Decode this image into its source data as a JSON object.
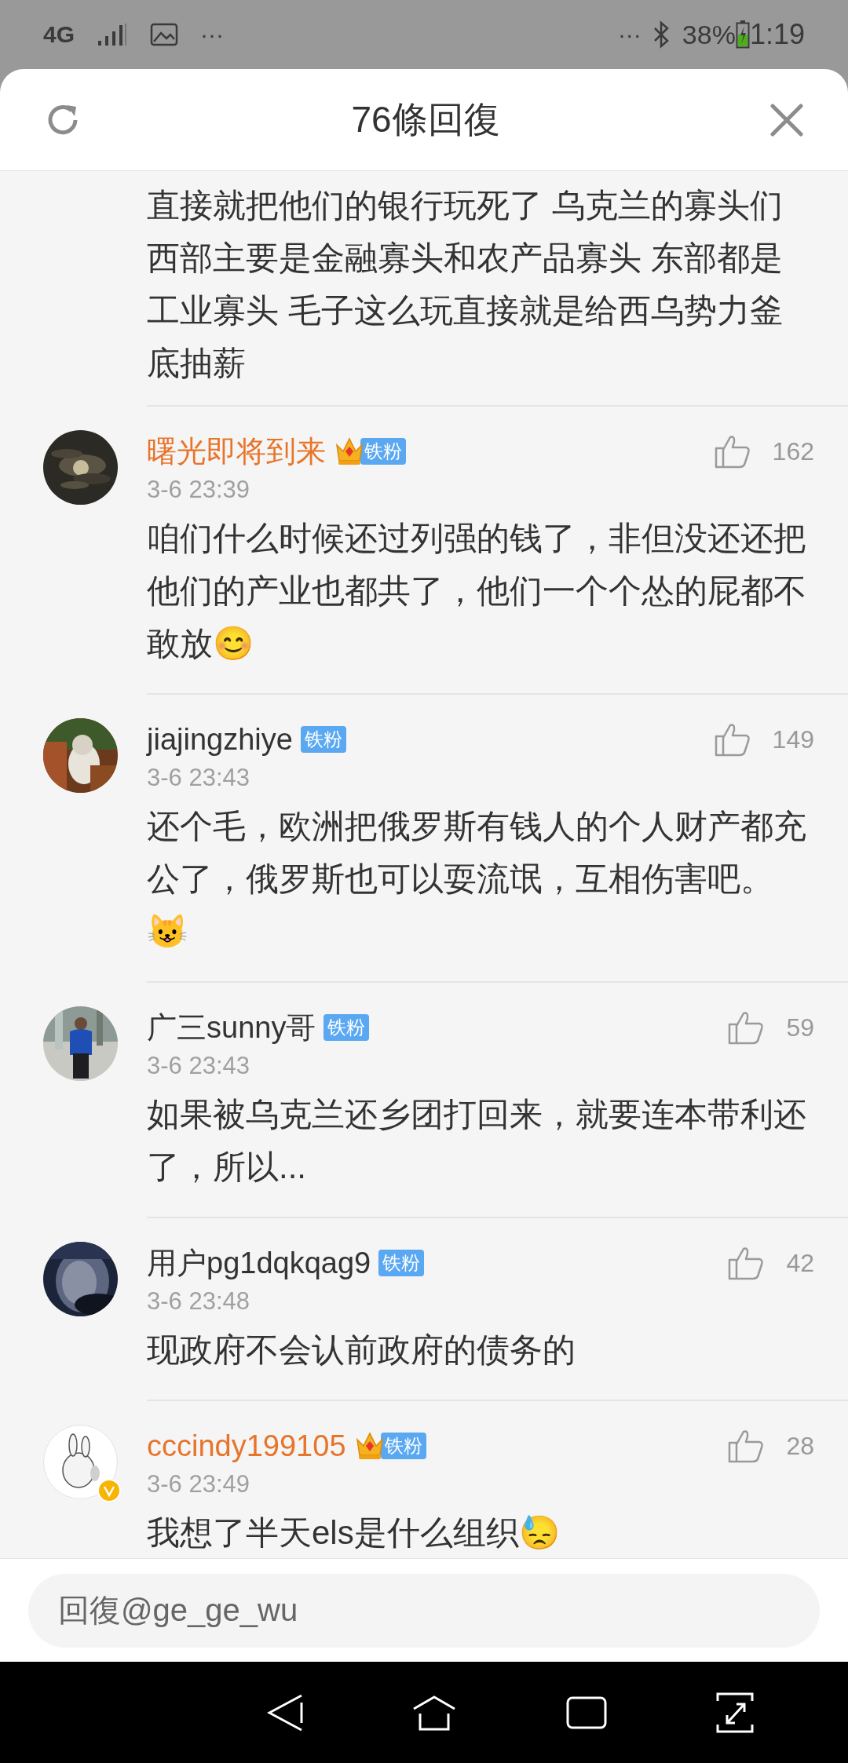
{
  "status_bar": {
    "network": "4G",
    "more_left": "···",
    "more_right": "···",
    "battery": "38%",
    "time": "1:19"
  },
  "header": {
    "title": "76條回復"
  },
  "comments": [
    {
      "kind": "continuation",
      "text": "直接就把他们的银行玩死了 乌克兰的寡头们西部主要是金融寡头和农产品寡头 东部都是工业寡头 毛子这么玩直接就是给西乌势力釜底抽薪"
    },
    {
      "kind": "full",
      "name": "曙光即将到来",
      "vip": true,
      "badge": "铁粉",
      "time": "3-6 23:39",
      "likes": "162",
      "text": "咱们什么时候还过列强的钱了，非但没还还把他们的产业也都共了，他们一个个怂的屁都不敢放😊",
      "verified": false
    },
    {
      "kind": "full",
      "name": "jiajingzhiye",
      "vip": false,
      "badge": "铁粉",
      "time": "3-6 23:43",
      "likes": "149",
      "text": "还个毛，欧洲把俄罗斯有钱人的个人财产都充公了，俄罗斯也可以耍流氓，互相伤害吧。\n😺",
      "verified": false
    },
    {
      "kind": "full",
      "name": "广三sunny哥",
      "vip": false,
      "badge": "铁粉",
      "time": "3-6 23:43",
      "likes": "59",
      "text": "如果被乌克兰还乡团打回来，就要连本带利还了，所以...",
      "verified": false
    },
    {
      "kind": "full",
      "name": "用户pg1dqkqag9",
      "vip": false,
      "badge": "铁粉",
      "time": "3-6 23:48",
      "likes": "42",
      "text": "现政府不会认前政府的债务的",
      "verified": false
    },
    {
      "kind": "full",
      "name": "cccindy199105",
      "vip": true,
      "badge": "铁粉",
      "time": "3-6 23:49",
      "likes": "28",
      "text": "我想了半天els是什么组织😓",
      "verified": true
    }
  ],
  "reply_field": {
    "placeholder": "回復@ge_ge_wu"
  }
}
